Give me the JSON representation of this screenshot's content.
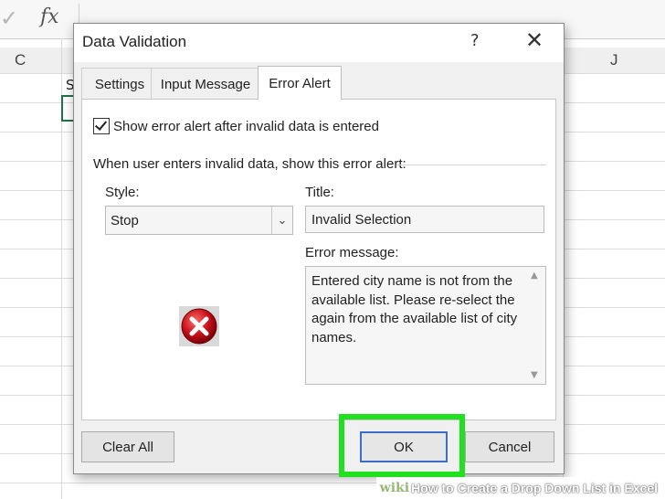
{
  "excel": {
    "fx_label": "fx",
    "check_glyph": "✓",
    "columns": [
      "C",
      "J"
    ],
    "cell_s": "S"
  },
  "dialog": {
    "title": "Data Validation",
    "help": "?",
    "close": "✕",
    "tabs": [
      {
        "label": "Settings",
        "active": false
      },
      {
        "label": "Input Message",
        "active": false
      },
      {
        "label": "Error Alert",
        "active": true
      }
    ],
    "show_alert": {
      "checked": true,
      "label": "Show error alert after invalid data is entered"
    },
    "group_label": "When user enters invalid data, show this error alert:",
    "style": {
      "label": "Style:",
      "value": "Stop"
    },
    "title_field": {
      "label": "Title:",
      "value": "Invalid Selection"
    },
    "message_field": {
      "label": "Error message:",
      "value": "Entered city name is not from the available list. Please re-select the again from the available list of city names."
    },
    "icon": "stop-error-icon",
    "buttons": {
      "clear_all": "Clear All",
      "ok": "OK",
      "cancel": "Cancel"
    }
  },
  "highlight_color": "#20e020",
  "watermark": {
    "wiki": "wiki",
    "text": "How to Create a Drop Down List in Excel"
  }
}
